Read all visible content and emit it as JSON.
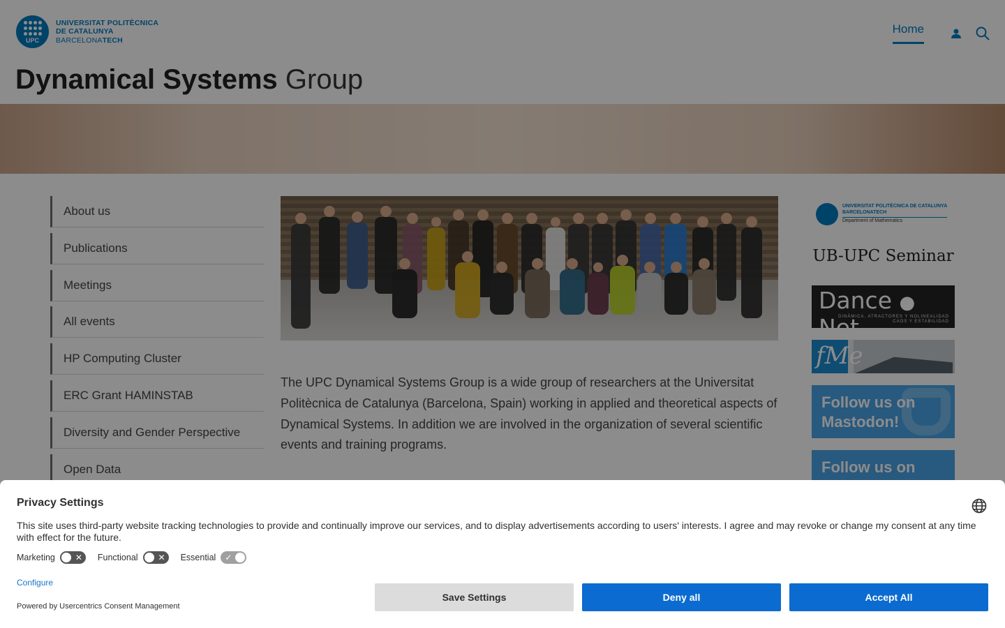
{
  "header": {
    "logo": {
      "emblem_text": "UPC",
      "line1": "UNIVERSITAT POLITÈCNICA",
      "line2": "DE CATALUNYA",
      "line3a": "BARCELONA",
      "line3b": "TECH"
    },
    "nav": {
      "home_label": "Home",
      "user_icon": "user-icon",
      "search_icon": "search-icon"
    },
    "site_title_bold": "Dynamical Systems",
    "site_title_regular": "Group"
  },
  "sidebar": {
    "items": [
      {
        "label": "About us"
      },
      {
        "label": "Publications"
      },
      {
        "label": "Meetings"
      },
      {
        "label": "All events"
      },
      {
        "label": "HP Computing Cluster"
      },
      {
        "label": "ERC Grant HAMINSTAB"
      },
      {
        "label": "Diversity and Gender Perspective"
      },
      {
        "label": "Open Data"
      }
    ]
  },
  "main": {
    "intro": "The UPC Dynamical Systems Group is a wide group of researchers at the Universitat Politècnica de Catalunya (Barcelona, Spain) working in applied and theoretical aspects of Dynamical Systems. In addition we are involved in the organization of several scientific events and training programs."
  },
  "right_column": {
    "dept": {
      "line1": "UNIVERSITAT POLITÈCNICA DE CATALUNYA",
      "line2": "BARCELONATECH",
      "line3": "Department of Mathematics"
    },
    "seminar": "UB-UPC Seminar",
    "dance": {
      "word1": "Dance",
      "word2": "Net",
      "sub1": "DINÁMICA, ATRACTORES Y NOLINEALIDAD",
      "sub2": "CAOS Y ESTABILIDAD"
    },
    "fme_text": "fMe",
    "follow1": "Follow us on Mastodon!",
    "follow2": "Follow us on"
  },
  "privacy": {
    "title": "Privacy Settings",
    "text": "This site uses third-party website tracking technologies to provide and continually improve our services, and to display advertisements according to users' interests. I agree and may revoke or change my consent at any time with effect for the future.",
    "toggles": [
      {
        "label": "Marketing",
        "state": "off"
      },
      {
        "label": "Functional",
        "state": "off"
      },
      {
        "label": "Essential",
        "state": "on"
      }
    ],
    "configure": "Configure",
    "powered": "Powered by Usercentrics Consent Management",
    "buttons": {
      "save": "Save Settings",
      "deny": "Deny all",
      "accept": "Accept All"
    },
    "language_icon": "globe-icon"
  },
  "colors": {
    "brand": "#007bc0",
    "button_primary": "#0b6bd0",
    "button_secondary": "#dcdcdc"
  }
}
